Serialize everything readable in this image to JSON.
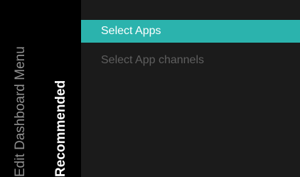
{
  "menu": {
    "parent_title": "Edit Dashboard Menu",
    "section_title": "Recommended",
    "items": [
      {
        "label": "Select Apps",
        "state": "selected"
      },
      {
        "label": "Select App channels",
        "state": "disabled"
      }
    ]
  },
  "colors": {
    "background": "#000000",
    "panel": "#1b1b1b",
    "highlight": "#2bb3ad",
    "parent_title_text": "#8f8f8f",
    "section_title_text": "#ffffff",
    "selected_text": "#ffffff",
    "disabled_text": "#5f5f5f"
  }
}
